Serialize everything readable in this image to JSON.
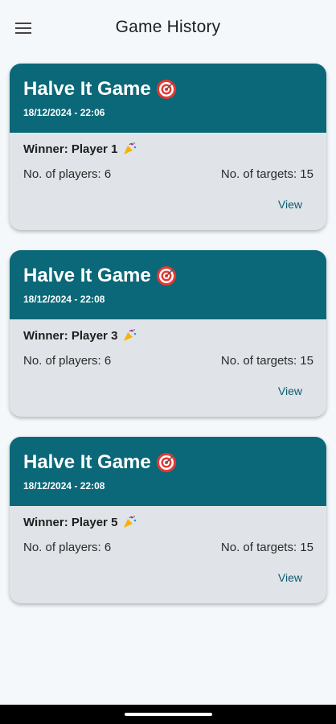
{
  "appbar": {
    "title": "Game History",
    "menu_icon": "hamburger-menu-icon"
  },
  "games": [
    {
      "title": "Halve It Game",
      "date": "18/12/2024 - 22:06",
      "winner": "Winner: Player 1",
      "players": "No. of players: 6",
      "targets": "No. of targets: 15",
      "view_label": "View"
    },
    {
      "title": "Halve It Game",
      "date": "18/12/2024 - 22:08",
      "winner": "Winner: Player 3",
      "players": "No. of players: 6",
      "targets": "No. of targets: 15",
      "view_label": "View"
    },
    {
      "title": "Halve It Game",
      "date": "18/12/2024 - 22:08",
      "winner": "Winner: Player 5",
      "players": "No. of players: 6",
      "targets": "No. of targets: 15",
      "view_label": "View"
    }
  ],
  "colors": {
    "header": "#0b6878",
    "card_body": "#e0e4e8",
    "background": "#f4f8fb",
    "link": "#0b5b70"
  }
}
